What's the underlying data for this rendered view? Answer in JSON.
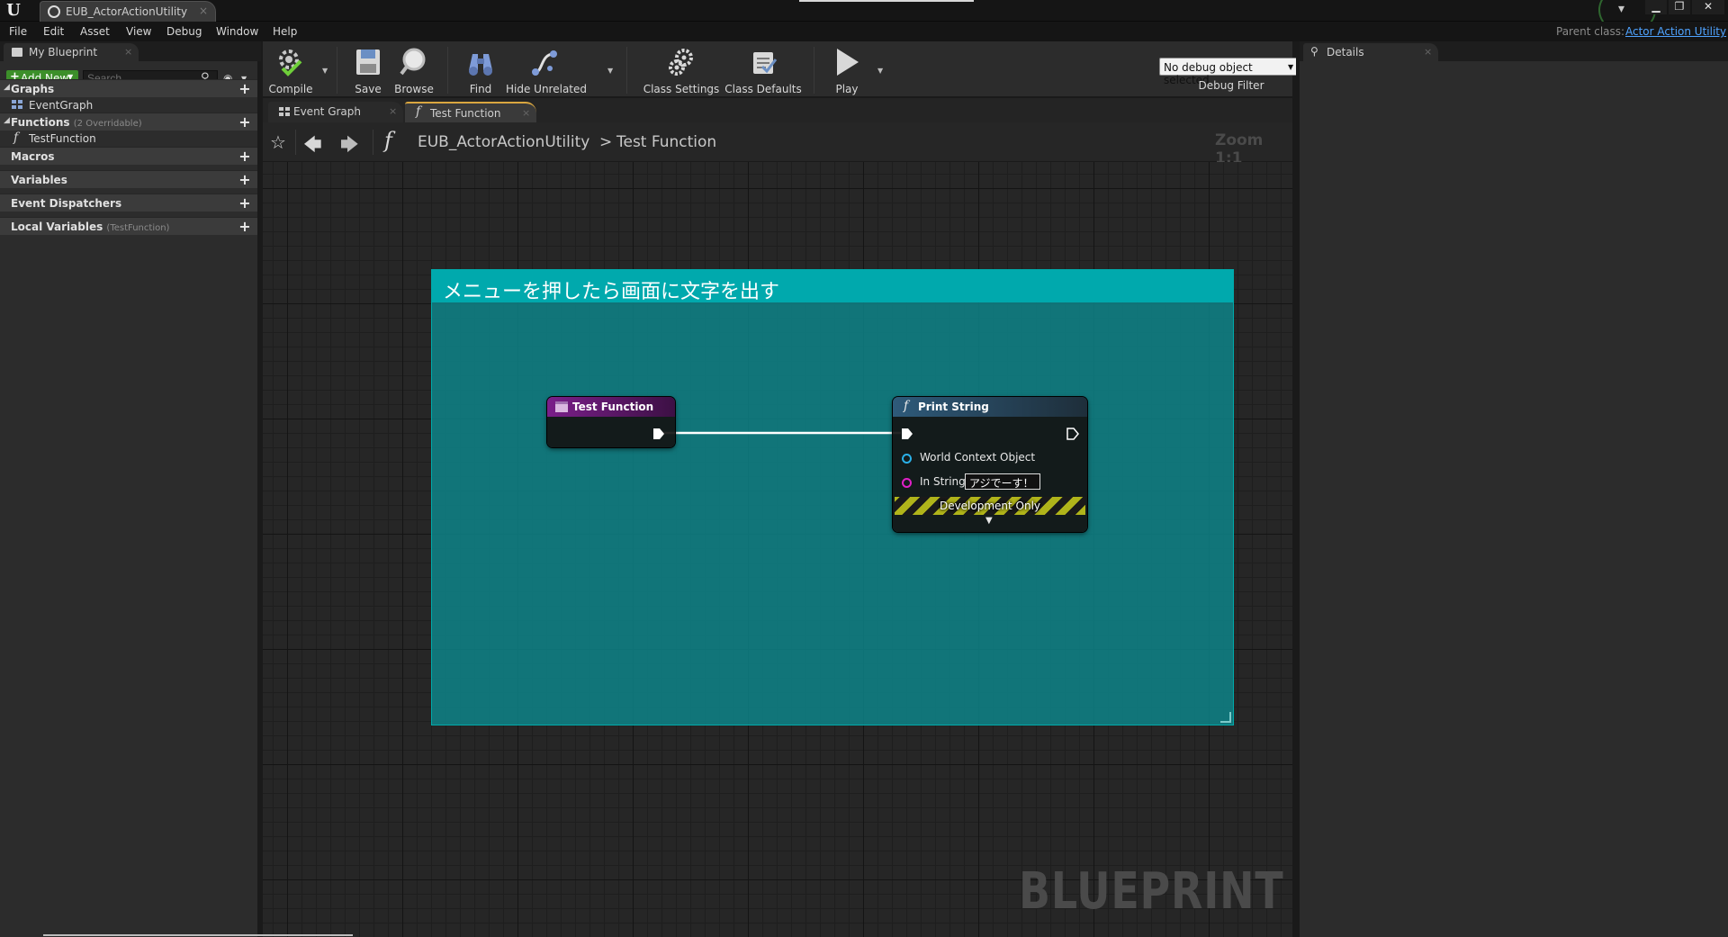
{
  "title_bar": {
    "app_logo": "U",
    "document_tab": {
      "label": "EUB_ActorActionUtility",
      "close": "×"
    },
    "window_buttons": {
      "minimize": "▁",
      "maximize": "❐",
      "close": "✕"
    }
  },
  "menu": {
    "items": [
      "File",
      "Edit",
      "Asset",
      "View",
      "Debug",
      "Window",
      "Help"
    ],
    "parent_class_label": "Parent class:",
    "parent_class_value": "Actor Action Utility"
  },
  "my_blueprint": {
    "tab_label": "My Blueprint",
    "tab_close": "×",
    "add_new_label": "Add New",
    "search_placeholder": "Search",
    "sections": {
      "graphs": {
        "label": "Graphs",
        "items": [
          "EventGraph"
        ]
      },
      "functions": {
        "label": "Functions",
        "sub": "(2 Overridable)",
        "items": [
          "TestFunction"
        ]
      },
      "macros": {
        "label": "Macros"
      },
      "variables": {
        "label": "Variables"
      },
      "event_dispatchers": {
        "label": "Event Dispatchers"
      },
      "local_variables": {
        "label": "Local Variables",
        "sub": "(TestFunction)"
      }
    }
  },
  "toolbar": {
    "compile": "Compile",
    "save": "Save",
    "browse": "Browse",
    "find": "Find",
    "hide_unrelated": "Hide Unrelated",
    "class_settings": "Class Settings",
    "class_defaults": "Class Defaults",
    "play": "Play",
    "debug_object": "No debug object selected",
    "debug_filter": "Debug Filter"
  },
  "graph_tabs": [
    {
      "label": "Event Graph",
      "close": "×"
    },
    {
      "label": "Test Function",
      "close": "×"
    }
  ],
  "breadcrumb": {
    "class_name": "EUB_ActorActionUtility",
    "separator": ">",
    "function_name": "Test Function",
    "zoom": "Zoom 1:1"
  },
  "graph": {
    "comment_title": "メニューを押したら画面に文字を出す",
    "watermark": "BLUEPRINT",
    "node_entry": {
      "title": "Test Function"
    },
    "node_print": {
      "title": "Print String",
      "pin_world_context": "World Context Object",
      "pin_in_string": "In String",
      "in_string_value": "アジでーす！",
      "development_only": "Development Only"
    }
  },
  "details": {
    "tab_label": "Details",
    "tab_close": "×"
  },
  "colors": {
    "comment_header": "#00a9ad",
    "comment_body": "#0e878c",
    "entry_node_header": "#7a1f8a",
    "function_node_header": "#2e5a7a",
    "add_new_green": "#3c8f2a",
    "link_blue": "#4fa3ff",
    "world_context_pin": "#2ab0e8",
    "string_pin": "#e020c8"
  },
  "icons": {
    "compile": "gear-check-icon",
    "save": "floppy-disk-icon",
    "browse": "magnifier-icon",
    "find": "binoculars-icon",
    "hide_unrelated": "node-graph-icon",
    "class_settings": "gears-icon",
    "class_defaults": "clipboard-check-icon",
    "play": "play-triangle-icon"
  }
}
